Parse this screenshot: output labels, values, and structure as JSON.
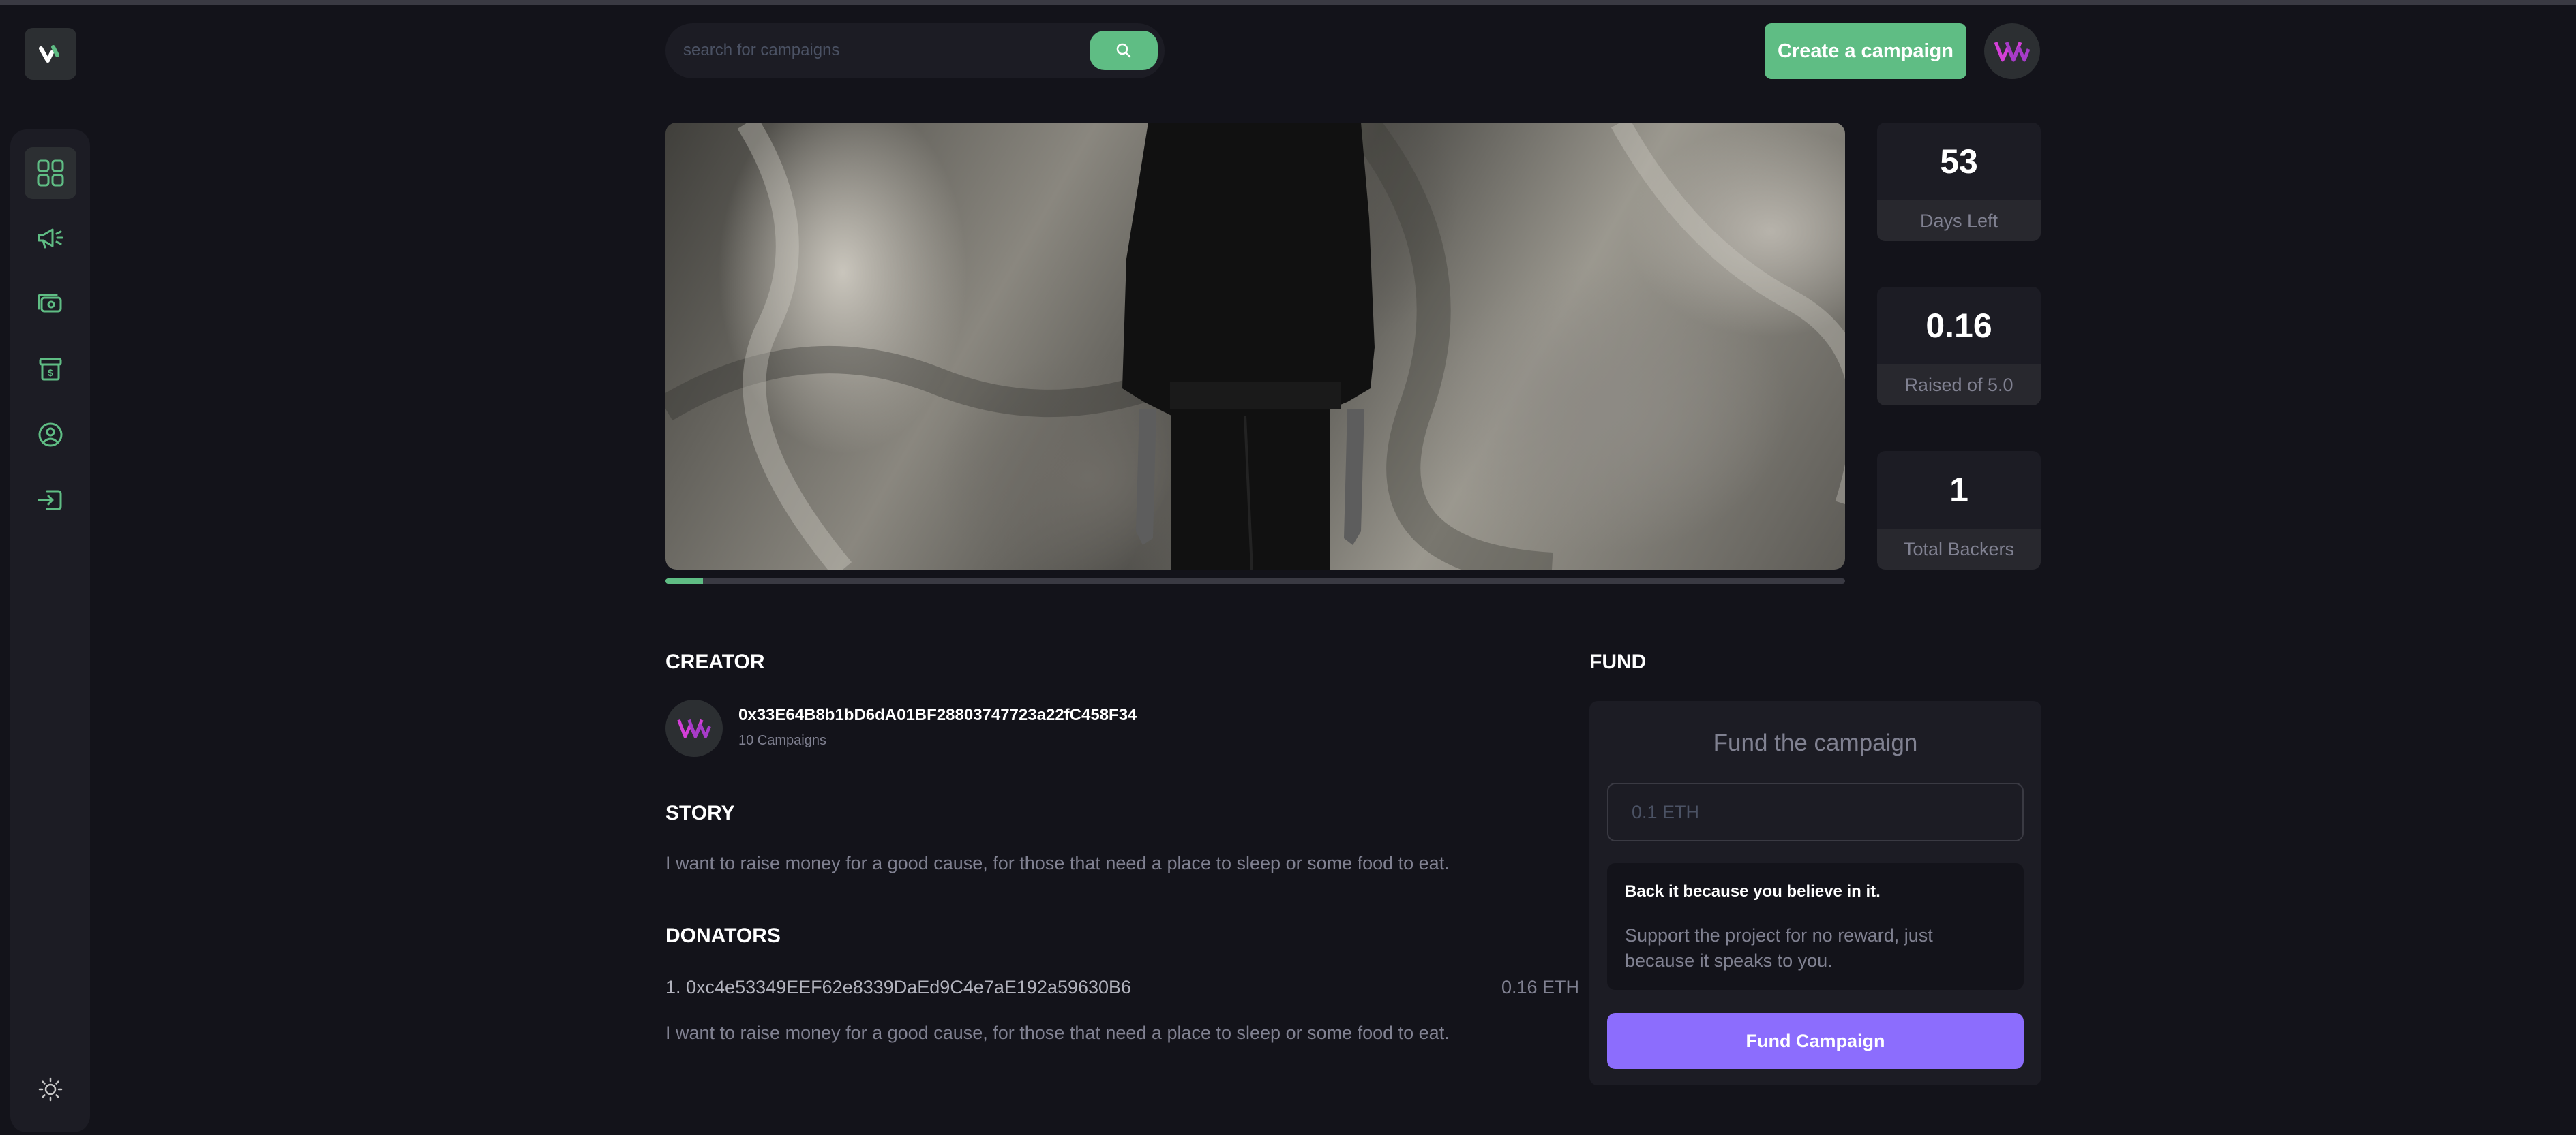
{
  "header": {
    "search_placeholder": "search for campaigns",
    "create_label": "Create a campaign"
  },
  "sidebar": {
    "items": [
      {
        "icon": "dashboard-icon",
        "active": true
      },
      {
        "icon": "megaphone-icon",
        "active": false
      },
      {
        "icon": "payment-icon",
        "active": false
      },
      {
        "icon": "withdraw-icon",
        "active": false
      },
      {
        "icon": "profile-icon",
        "active": false
      },
      {
        "icon": "logout-icon",
        "active": false
      }
    ],
    "theme_icon": "sun-icon"
  },
  "campaign": {
    "progress_percent": 3.2
  },
  "stats": [
    {
      "value": "53",
      "label": "Days Left"
    },
    {
      "value": "0.16",
      "label": "Raised of 5.0"
    },
    {
      "value": "1",
      "label": "Total Backers"
    }
  ],
  "creator": {
    "title": "CREATOR",
    "address": "0x33E64B8b1bD6dA01BF28803747723a22fC458F34",
    "campaigns": "10 Campaigns"
  },
  "story": {
    "title": "STORY",
    "text": "I want to raise money for a good cause, for those that need a place to sleep or some food to eat."
  },
  "donators": {
    "title": "DONATORS",
    "entries": [
      {
        "address": "1. 0xc4e53349EEF62e8339DaEd9C4e7aE192a59630B6",
        "amount": "0.16 ETH"
      }
    ],
    "note": "I want to raise money for a good cause, for those that need a place to sleep or some food to eat."
  },
  "fund": {
    "title": "FUND",
    "heading": "Fund the campaign",
    "input_placeholder": "0.1 ETH",
    "believe_title": "Back it because you believe in it.",
    "believe_desc": "Support the project for no reward, just because it speaks to you.",
    "button_label": "Fund Campaign"
  },
  "colors": {
    "background": "#13131a",
    "panel": "#1c1c24",
    "accent_green": "#5fbd84",
    "accent_purple": "#8c6dfd",
    "muted_text": "#808191"
  }
}
